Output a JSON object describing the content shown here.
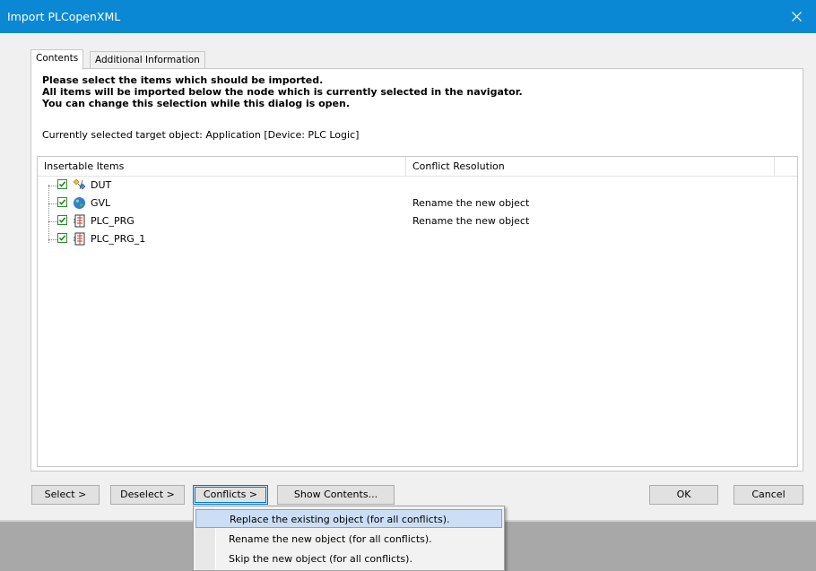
{
  "window": {
    "title": "Import PLCopenXML"
  },
  "tabs": [
    {
      "label": "Contents",
      "active": true
    },
    {
      "label": "Additional Information",
      "active": false
    }
  ],
  "instructions": [
    "Please select the items which should be imported.",
    "All items will be imported below the node which is currently selected in the navigator.",
    "You can change this selection while this dialog is open."
  ],
  "target": {
    "label": "Currently selected target object:",
    "value": "Application [Device: PLC Logic]"
  },
  "grid": {
    "columns": [
      "Insertable Items",
      "Conflict Resolution"
    ],
    "rows": [
      {
        "name": "DUT",
        "icon": "dut-icon",
        "checked": true,
        "conflict": ""
      },
      {
        "name": "GVL",
        "icon": "globe-icon",
        "checked": true,
        "conflict": "Rename the new object"
      },
      {
        "name": "PLC_PRG",
        "icon": "pou-icon",
        "checked": true,
        "conflict": "Rename the new object"
      },
      {
        "name": "PLC_PRG_1",
        "icon": "pou-icon",
        "checked": true,
        "conflict": ""
      }
    ]
  },
  "buttons": {
    "select": "Select >",
    "deselect": "Deselect >",
    "conflicts": "Conflicts >",
    "show_contents": "Show Contents...",
    "ok": "OK",
    "cancel": "Cancel"
  },
  "conflicts_menu": {
    "items": [
      {
        "label": "Replace the existing object (for all conflicts).",
        "highlighted": true
      },
      {
        "label": "Rename the new object (for all conflicts).",
        "highlighted": false
      },
      {
        "label": "Skip the new object (for all conflicts).",
        "highlighted": false
      }
    ]
  },
  "colors": {
    "titlebar": "#0a88d4",
    "checkbox": "#2e8b2e",
    "menu_highlight": "#ccdef5"
  }
}
